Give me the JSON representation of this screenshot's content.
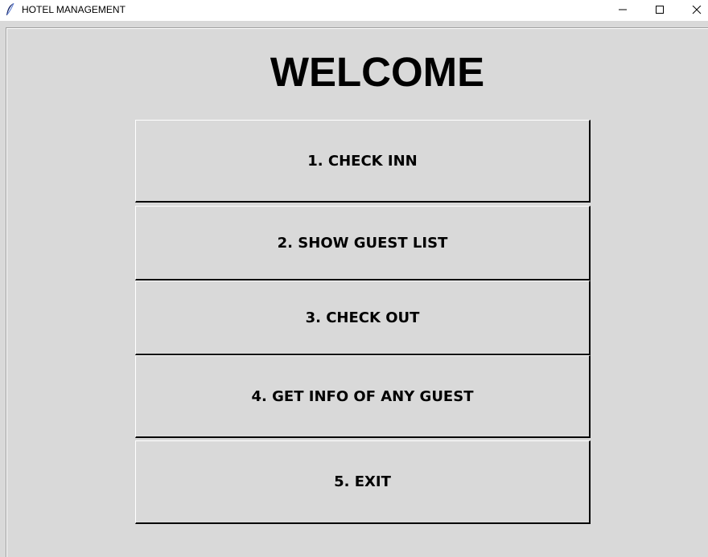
{
  "window": {
    "title": "HOTEL MANAGEMENT",
    "icon": "feather-icon",
    "controls": [
      "minimize-icon",
      "maximize-icon",
      "close-icon"
    ]
  },
  "main": {
    "heading": "WELCOME",
    "buttons": [
      {
        "label": "1. CHECK INN"
      },
      {
        "label": "2. SHOW GUEST LIST"
      },
      {
        "label": "3. CHECK OUT"
      },
      {
        "label": "4. GET INFO OF ANY GUEST"
      },
      {
        "label": "5. EXIT"
      }
    ]
  },
  "colors": {
    "background": "#d9d9d9",
    "titlebar": "#ffffff",
    "text": "#000000"
  }
}
